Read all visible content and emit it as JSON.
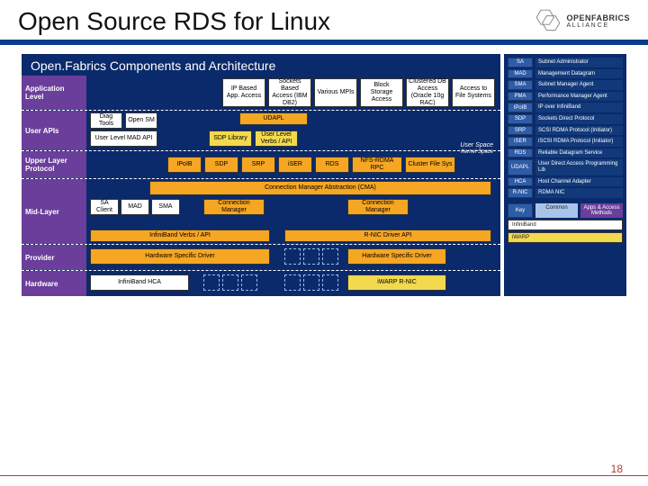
{
  "header": {
    "title": "Open Source RDS for Linux",
    "logo_brand": "OPENFABRICS",
    "logo_sub": "A L L I A N C E"
  },
  "diagram": {
    "title": "Open.Fabrics Components and Architecture",
    "rows": {
      "app": {
        "label": "Application Level",
        "boxes": [
          "IP Based App. Access",
          "Sockets Based Access (IBM DB2)",
          "Various MPIs",
          "Block Storage Access",
          "Clustered DB Access (Oracle 10g RAC)",
          "Access to File Systems"
        ]
      },
      "api": {
        "label": "User APIs",
        "top": [
          "Diag Tools",
          "Open SM"
        ],
        "udapl": "UDAPL",
        "mad": "User Level MAD API",
        "bot": [
          "SDP Library",
          "User Level Verbs / API"
        ],
        "space": "User Space",
        "kernel": "Kernel Space"
      },
      "ulp": {
        "label": "Upper Layer Protocol",
        "boxes": [
          "IPoIB",
          "SDP",
          "SRP",
          "iSER",
          "RDS",
          "NFS-RDMA RPC",
          "Cluster File Sys"
        ]
      },
      "mid": {
        "label": "Mid-Layer",
        "cma": "Connection Manager Abstraction (CMA)",
        "left": [
          "SA Client",
          "MAD",
          "SMA"
        ],
        "cm": "Connection Manager",
        "verbs": "InfiniBand Verbs / API",
        "rnic": "R-NIC Driver API"
      },
      "prov": {
        "label": "Provider",
        "hsd": "Hardware Specific Driver"
      },
      "hw": {
        "label": "Hardware",
        "hca": "InfiniBand HCA",
        "nic": "iWARP R-NIC"
      }
    }
  },
  "legend": {
    "items": [
      {
        "k": "SA",
        "v": "Subnet Administrator"
      },
      {
        "k": "MAD",
        "v": "Management Datagram"
      },
      {
        "k": "SMA",
        "v": "Subnet Manager Agent"
      },
      {
        "k": "PMA",
        "v": "Performance Manager Agent"
      },
      {
        "k": "IPoIB",
        "v": "IP over InfiniBand"
      },
      {
        "k": "SDP",
        "v": "Sockets Direct Protocol"
      },
      {
        "k": "SRP",
        "v": "SCSI RDMA Protocol (Initiator)"
      },
      {
        "k": "iSER",
        "v": "iSCSI RDMA Protocol (Initiator)"
      },
      {
        "k": "RDS",
        "v": "Reliable Datagram Service"
      },
      {
        "k": "UDAPL",
        "v": "User Direct Access Programming Lib"
      },
      {
        "k": "HCA",
        "v": "Host Channel Adapter"
      },
      {
        "k": "R-NIC",
        "v": "RDMA NIC"
      }
    ],
    "key": "Key",
    "common": "Common",
    "apps": "Apps & Access Methods",
    "ib": "InfiniBand",
    "iw": "iWARP"
  },
  "page": "18"
}
